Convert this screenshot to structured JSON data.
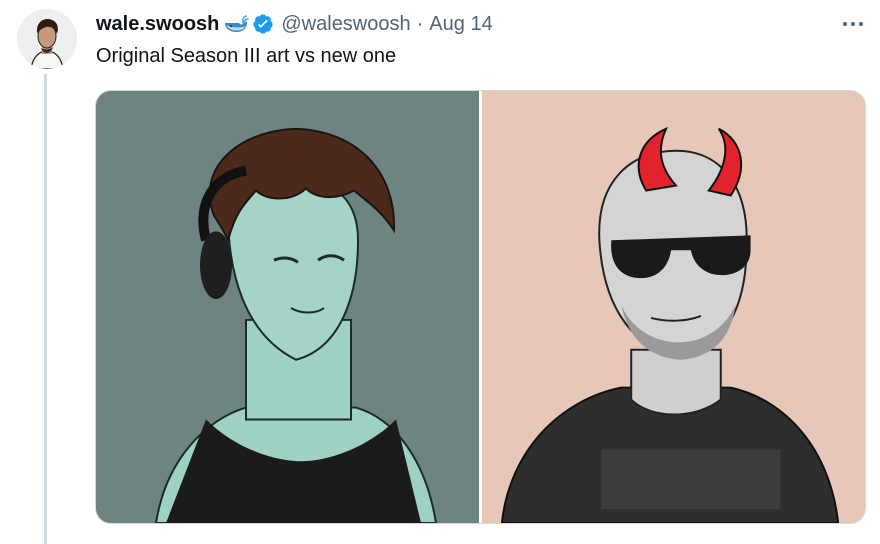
{
  "tweet": {
    "display_name": "wale.swoosh",
    "handle": "@waleswoosh",
    "separator": "·",
    "date": "Aug 14",
    "text": "Original Season III art vs new one",
    "more_label": "···"
  },
  "icons": {
    "name_emoji": "whale-icon",
    "verified": "verified-badge-icon",
    "more": "more-options-icon"
  },
  "colors": {
    "verified_blue": "#1d9bf0",
    "left_panel_bg": "#6e8482",
    "right_panel_bg": "#e6c7b8"
  }
}
